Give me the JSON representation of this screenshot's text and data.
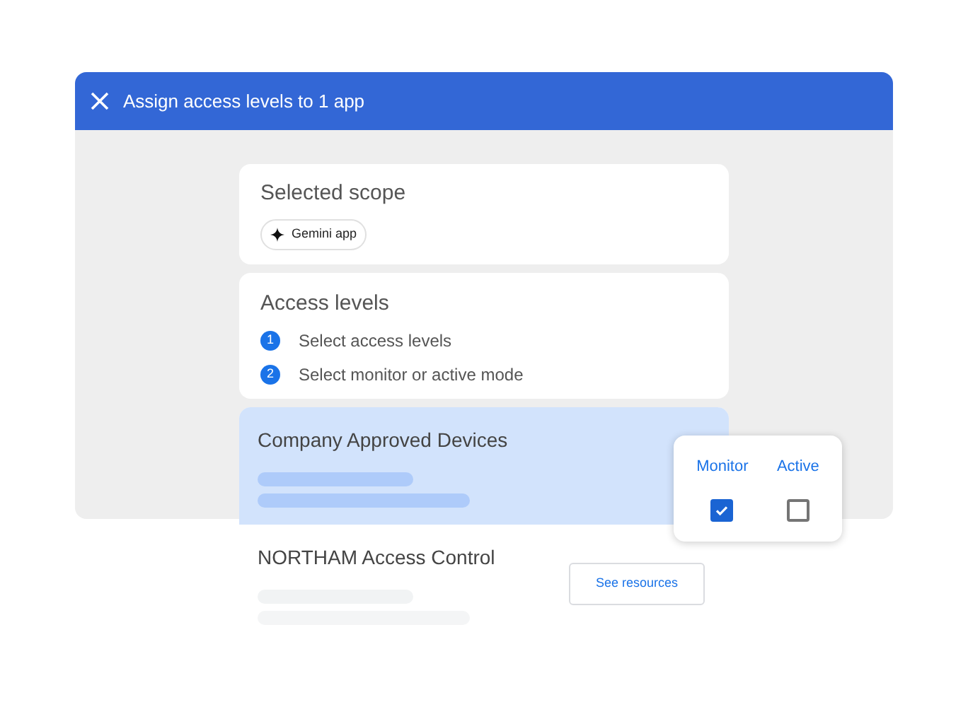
{
  "window": {
    "title": "Assign access levels to 1 app"
  },
  "scope": {
    "title": "Selected scope",
    "chip": "Gemini app"
  },
  "access_levels": {
    "title": "Access levels",
    "steps": [
      {
        "number": "1",
        "label": "Select access levels"
      },
      {
        "number": "2",
        "label": "Select monitor or active mode"
      }
    ]
  },
  "levels": [
    {
      "name": "Company Approved Devices",
      "selected": true
    },
    {
      "name": "NORTHAM Access Control",
      "selected": false,
      "button": "See resources"
    }
  ],
  "mode_popup": {
    "options": [
      {
        "label": "Monitor",
        "checked": true
      },
      {
        "label": "Active",
        "checked": false
      }
    ]
  }
}
